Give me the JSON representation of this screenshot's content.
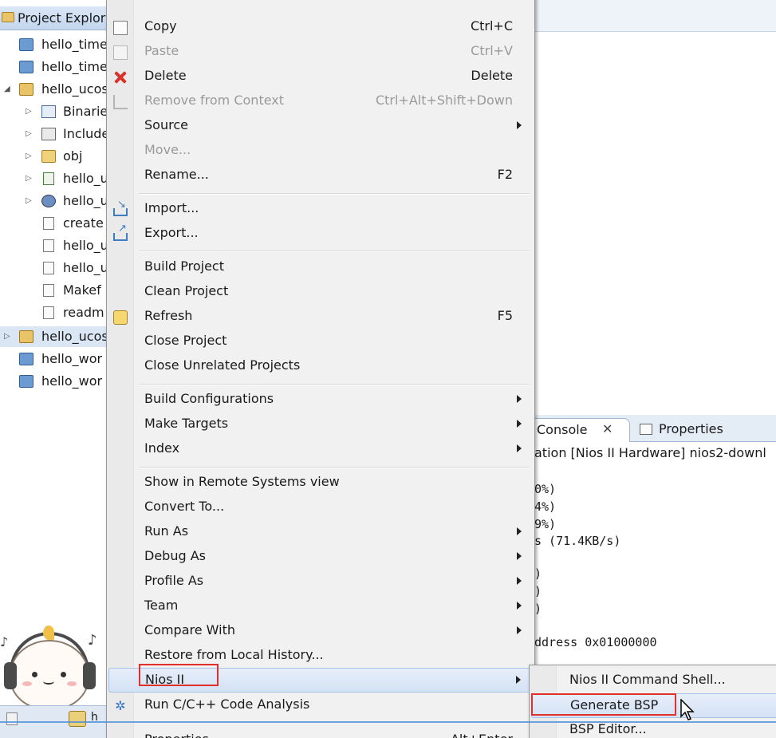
{
  "explorer": {
    "title": "Project Explor",
    "items": [
      {
        "label": "hello_time",
        "icon": "folder-closed-icon"
      },
      {
        "label": "hello_time",
        "icon": "folder-closed-icon"
      },
      {
        "label": "hello_ucos",
        "icon": "c-project-open-icon"
      },
      {
        "label": "Binarie",
        "icon": "binaries-icon"
      },
      {
        "label": "Include",
        "icon": "includes-icon"
      },
      {
        "label": "obj",
        "icon": "folder-open-icon"
      },
      {
        "label": "hello_u",
        "icon": "executable-icon"
      },
      {
        "label": "hello_u",
        "icon": "gear-icon"
      },
      {
        "label": "create",
        "icon": "file-icon"
      },
      {
        "label": "hello_u",
        "icon": "file-icon"
      },
      {
        "label": "hello_u",
        "icon": "file-icon"
      },
      {
        "label": "Makef",
        "icon": "makefile-icon"
      },
      {
        "label": "readm",
        "icon": "file-icon"
      },
      {
        "label": "hello_ucos",
        "icon": "c-project-open-icon"
      },
      {
        "label": "hello_wor",
        "icon": "folder-closed-icon"
      },
      {
        "label": "hello_wor",
        "icon": "folder-closed-icon"
      }
    ],
    "status_text": "h"
  },
  "menu": {
    "items": [
      {
        "label": "Copy",
        "shortcut": "Ctrl+C",
        "icon": "copy-icon"
      },
      {
        "label": "Paste",
        "shortcut": "Ctrl+V",
        "icon": "paste-icon"
      },
      {
        "label": "Delete",
        "shortcut": "Delete",
        "icon": "delete-icon"
      },
      {
        "label": "Remove from Context",
        "shortcut": "Ctrl+Alt+Shift+Down",
        "icon": "remove-context-icon"
      },
      {
        "label": "Source"
      },
      {
        "label": "Move..."
      },
      {
        "label": "Rename...",
        "shortcut": "F2"
      },
      {
        "label": "Import...",
        "icon": "import-icon"
      },
      {
        "label": "Export...",
        "icon": "export-icon"
      },
      {
        "label": "Build Project"
      },
      {
        "label": "Clean Project"
      },
      {
        "label": "Refresh",
        "shortcut": "F5",
        "icon": "refresh-icon"
      },
      {
        "label": "Close Project"
      },
      {
        "label": "Close Unrelated Projects"
      },
      {
        "label": "Build Configurations"
      },
      {
        "label": "Make Targets"
      },
      {
        "label": "Index"
      },
      {
        "label": "Show in Remote Systems view"
      },
      {
        "label": "Convert To..."
      },
      {
        "label": "Run As"
      },
      {
        "label": "Debug As"
      },
      {
        "label": "Profile As"
      },
      {
        "label": "Team"
      },
      {
        "label": "Compare With"
      },
      {
        "label": "Restore from Local History..."
      },
      {
        "label": "Nios II"
      },
      {
        "label": "Run C/C++ Code Analysis",
        "icon": "code-analysis-icon"
      },
      {
        "label": "Properties",
        "shortcut": "Alt+Enter"
      }
    ]
  },
  "submenu": {
    "items": [
      {
        "label": "Nios II Command Shell..."
      },
      {
        "label": "Generate BSP"
      },
      {
        "label": "BSP Editor..."
      }
    ]
  },
  "console": {
    "tab_label": "Console",
    "properties_label": "Properties",
    "launch_text": "ation [Nios II Hardware] nios2-downl",
    "lines": [
      "0%)",
      "4%)",
      "9%)",
      "s (71.4KB/s)",
      ")",
      ")",
      ")",
      "ddress 0x01000000"
    ]
  },
  "colors": {
    "annotation_red": "#e0302b",
    "menu_background": "#f1f1f1",
    "hover_blue": "#d4e2f5"
  }
}
